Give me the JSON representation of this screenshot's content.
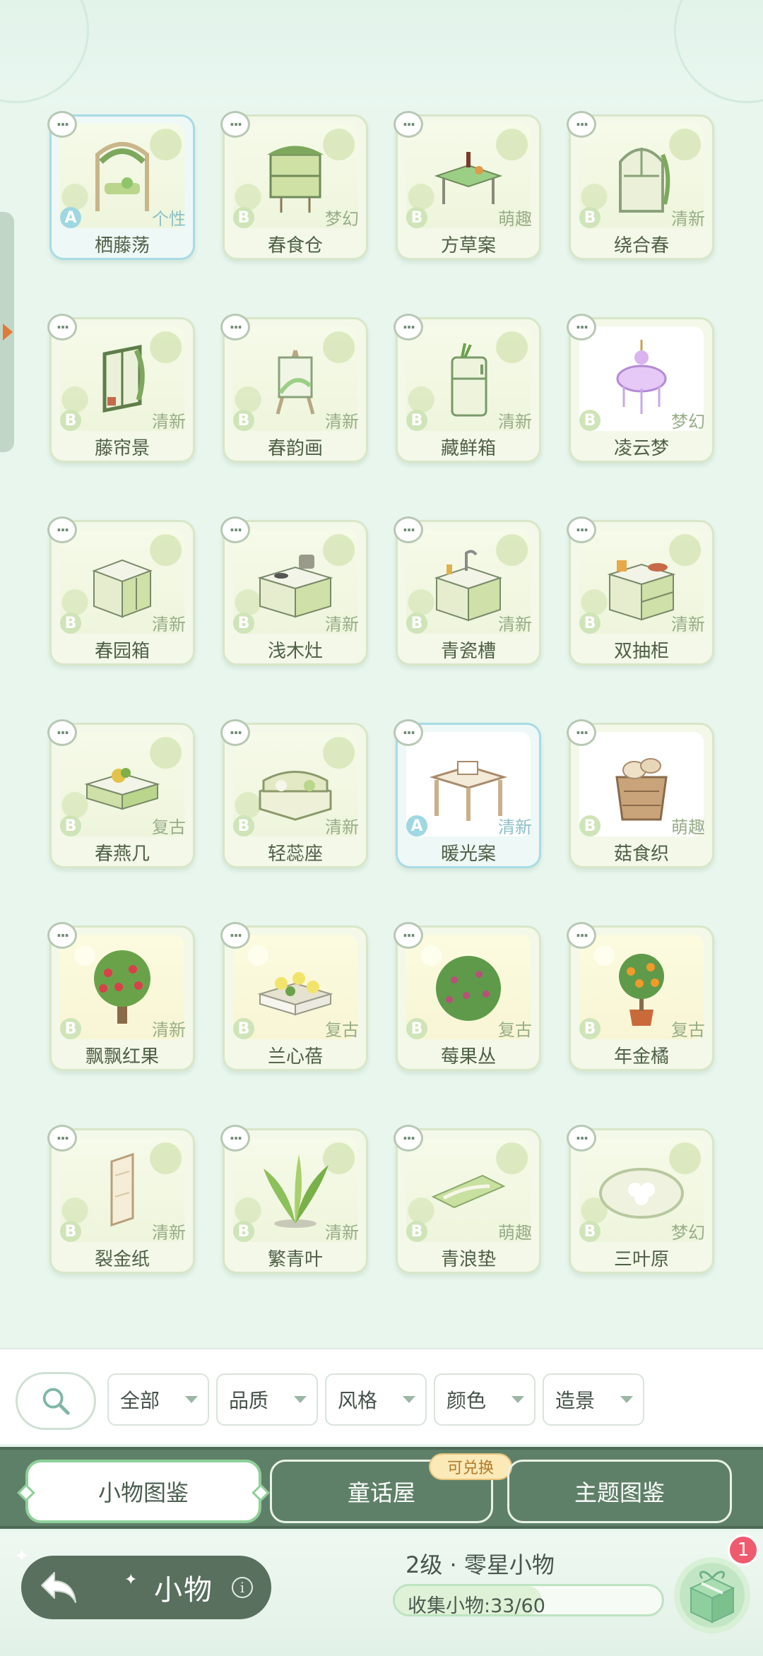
{
  "items": [
    {
      "name": "栖藤荡",
      "style": "个性",
      "rarity": "A",
      "icon": "vine-swing-icon",
      "bg": "leaf"
    },
    {
      "name": "春食仓",
      "style": "梦幻",
      "rarity": "B",
      "icon": "garden-cabinet-icon",
      "bg": "leaf"
    },
    {
      "name": "方草案",
      "style": "萌趣",
      "rarity": "B",
      "icon": "dining-table-icon",
      "bg": "leaf"
    },
    {
      "name": "绕合春",
      "style": "清新",
      "rarity": "B",
      "icon": "arched-door-icon",
      "bg": "leaf"
    },
    {
      "name": "藤帘景",
      "style": "清新",
      "rarity": "B",
      "icon": "vine-window-icon",
      "bg": "leaf"
    },
    {
      "name": "春韵画",
      "style": "清新",
      "rarity": "B",
      "icon": "easel-icon",
      "bg": "leaf"
    },
    {
      "name": "藏鲜箱",
      "style": "清新",
      "rarity": "B",
      "icon": "fridge-icon",
      "bg": "leaf"
    },
    {
      "name": "凌云梦",
      "style": "梦幻",
      "rarity": "B",
      "icon": "chandelier-icon",
      "bg": "white"
    },
    {
      "name": "春园箱",
      "style": "清新",
      "rarity": "B",
      "icon": "cabinet-icon",
      "bg": "leaf"
    },
    {
      "name": "浅木灶",
      "style": "清新",
      "rarity": "B",
      "icon": "stove-icon",
      "bg": "leaf"
    },
    {
      "name": "青瓷槽",
      "style": "清新",
      "rarity": "B",
      "icon": "sink-icon",
      "bg": "leaf"
    },
    {
      "name": "双抽柜",
      "style": "清新",
      "rarity": "B",
      "icon": "drawer-cabinet-icon",
      "bg": "leaf"
    },
    {
      "name": "春燕几",
      "style": "复古",
      "rarity": "B",
      "icon": "coffee-table-icon",
      "bg": "leaf"
    },
    {
      "name": "轻蕊座",
      "style": "清新",
      "rarity": "B",
      "icon": "sofa-icon",
      "bg": "leaf"
    },
    {
      "name": "暖光案",
      "style": "清新",
      "rarity": "A",
      "icon": "wooden-desk-icon",
      "bg": "white"
    },
    {
      "name": "菇食织",
      "style": "萌趣",
      "rarity": "B",
      "icon": "mushroom-basket-icon",
      "bg": "white"
    },
    {
      "name": "飘飘红果",
      "style": "清新",
      "rarity": "B",
      "icon": "red-fruit-tree-icon",
      "bg": "yellow"
    },
    {
      "name": "兰心蓓",
      "style": "复古",
      "rarity": "B",
      "icon": "flower-bed-icon",
      "bg": "yellow"
    },
    {
      "name": "莓果丛",
      "style": "复古",
      "rarity": "B",
      "icon": "berry-bush-icon",
      "bg": "yellow"
    },
    {
      "name": "年金橘",
      "style": "复古",
      "rarity": "B",
      "icon": "orange-tree-icon",
      "bg": "yellow"
    },
    {
      "name": "裂金纸",
      "style": "清新",
      "rarity": "B",
      "icon": "wallpaper-icon",
      "bg": "leaf"
    },
    {
      "name": "繁青叶",
      "style": "清新",
      "rarity": "B",
      "icon": "leafy-plant-icon",
      "bg": "leaf"
    },
    {
      "name": "青浪垫",
      "style": "萌趣",
      "rarity": "B",
      "icon": "rug-icon",
      "bg": "leaf"
    },
    {
      "name": "三叶原",
      "style": "梦幻",
      "rarity": "B",
      "icon": "clover-rug-icon",
      "bg": "leaf"
    }
  ],
  "filters": [
    {
      "label": "全部"
    },
    {
      "label": "品质"
    },
    {
      "label": "风格"
    },
    {
      "label": "颜色"
    },
    {
      "label": "造景"
    }
  ],
  "tabs": [
    {
      "label": "小物图鉴",
      "active": true
    },
    {
      "label": "童话屋",
      "active": false,
      "badge": "可兑换"
    },
    {
      "label": "主题图鉴",
      "active": false
    }
  ],
  "footer": {
    "category": "小物",
    "info_glyph": "i",
    "level_text": "2级 · 零星小物",
    "collection_text": "收集小物:33/60",
    "collected": 33,
    "total": 60,
    "gift_count": "1"
  },
  "more_glyph": "···",
  "colors": {
    "accent": "#8ed09a",
    "tab_bar": "#5f8068",
    "card_border": "#d9e6c8",
    "rarity_a": "#9fd7e2",
    "rarity_b": "#cfe4b8"
  }
}
